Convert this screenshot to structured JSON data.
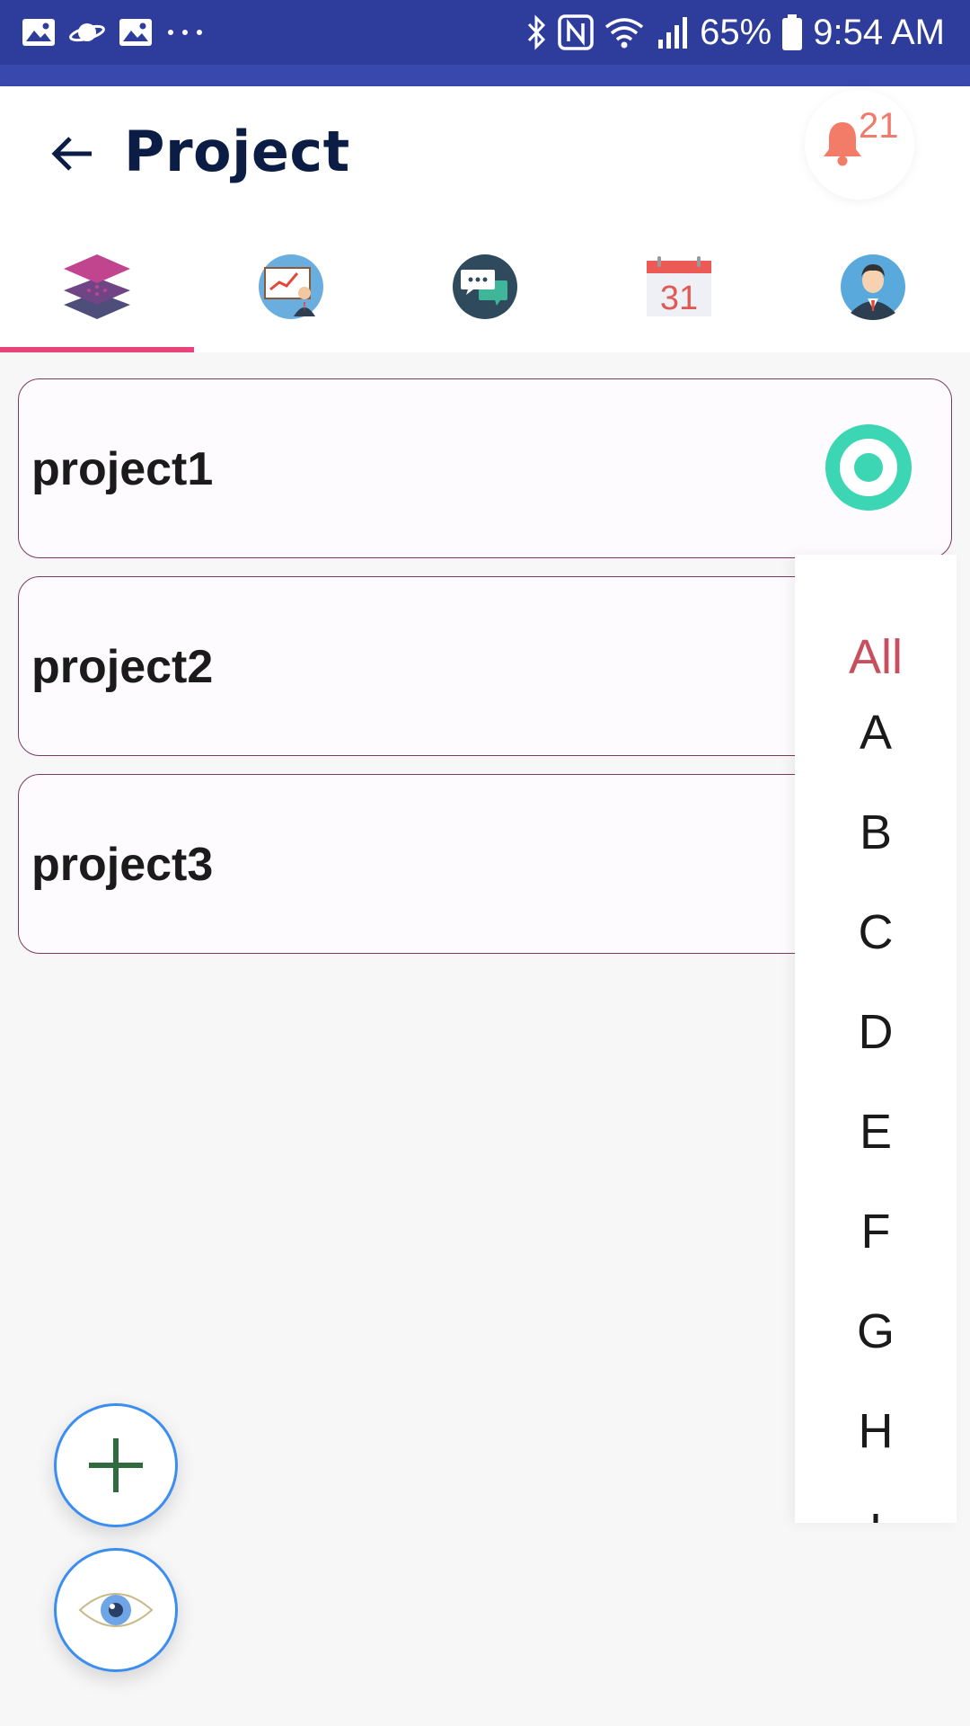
{
  "status_bar": {
    "battery": "65%",
    "time": "9:54 AM",
    "icons": [
      "image-icon",
      "saturn-icon",
      "image-icon",
      "more-dots-icon",
      "bluetooth-icon",
      "nfc-icon",
      "wifi-icon",
      "signal-icon",
      "battery-icon"
    ]
  },
  "header": {
    "title": "Project",
    "notification_count": "21",
    "accent": "#2e3c9c",
    "title_color": "#0b1d45"
  },
  "tabs": [
    {
      "name": "tab-projects",
      "icon": "layers-icon",
      "active": true
    },
    {
      "name": "tab-presentation",
      "icon": "presentation-icon",
      "active": false
    },
    {
      "name": "tab-chat",
      "icon": "chat-icon",
      "active": false
    },
    {
      "name": "tab-calendar",
      "icon": "calendar-icon",
      "calendar_day": "31",
      "active": false
    },
    {
      "name": "tab-profile",
      "icon": "user-avatar-icon",
      "active": false
    }
  ],
  "projects": [
    {
      "name": "project1",
      "selected": true
    },
    {
      "name": "project2",
      "selected": false
    },
    {
      "name": "project3",
      "selected": false
    }
  ],
  "alphabet_index": {
    "all_label": "All",
    "letters": [
      "A",
      "B",
      "C",
      "D",
      "E",
      "F",
      "G",
      "H",
      "I"
    ],
    "active_color": "#c8505e"
  },
  "fabs": {
    "add_icon": "plus-icon",
    "view_icon": "eye-icon"
  },
  "colors": {
    "tab_indicator": "#e8447a",
    "selected_ring": "#3dd6b5",
    "fab_border": "#3b8ef0",
    "card_border": "#7b3a5f"
  }
}
